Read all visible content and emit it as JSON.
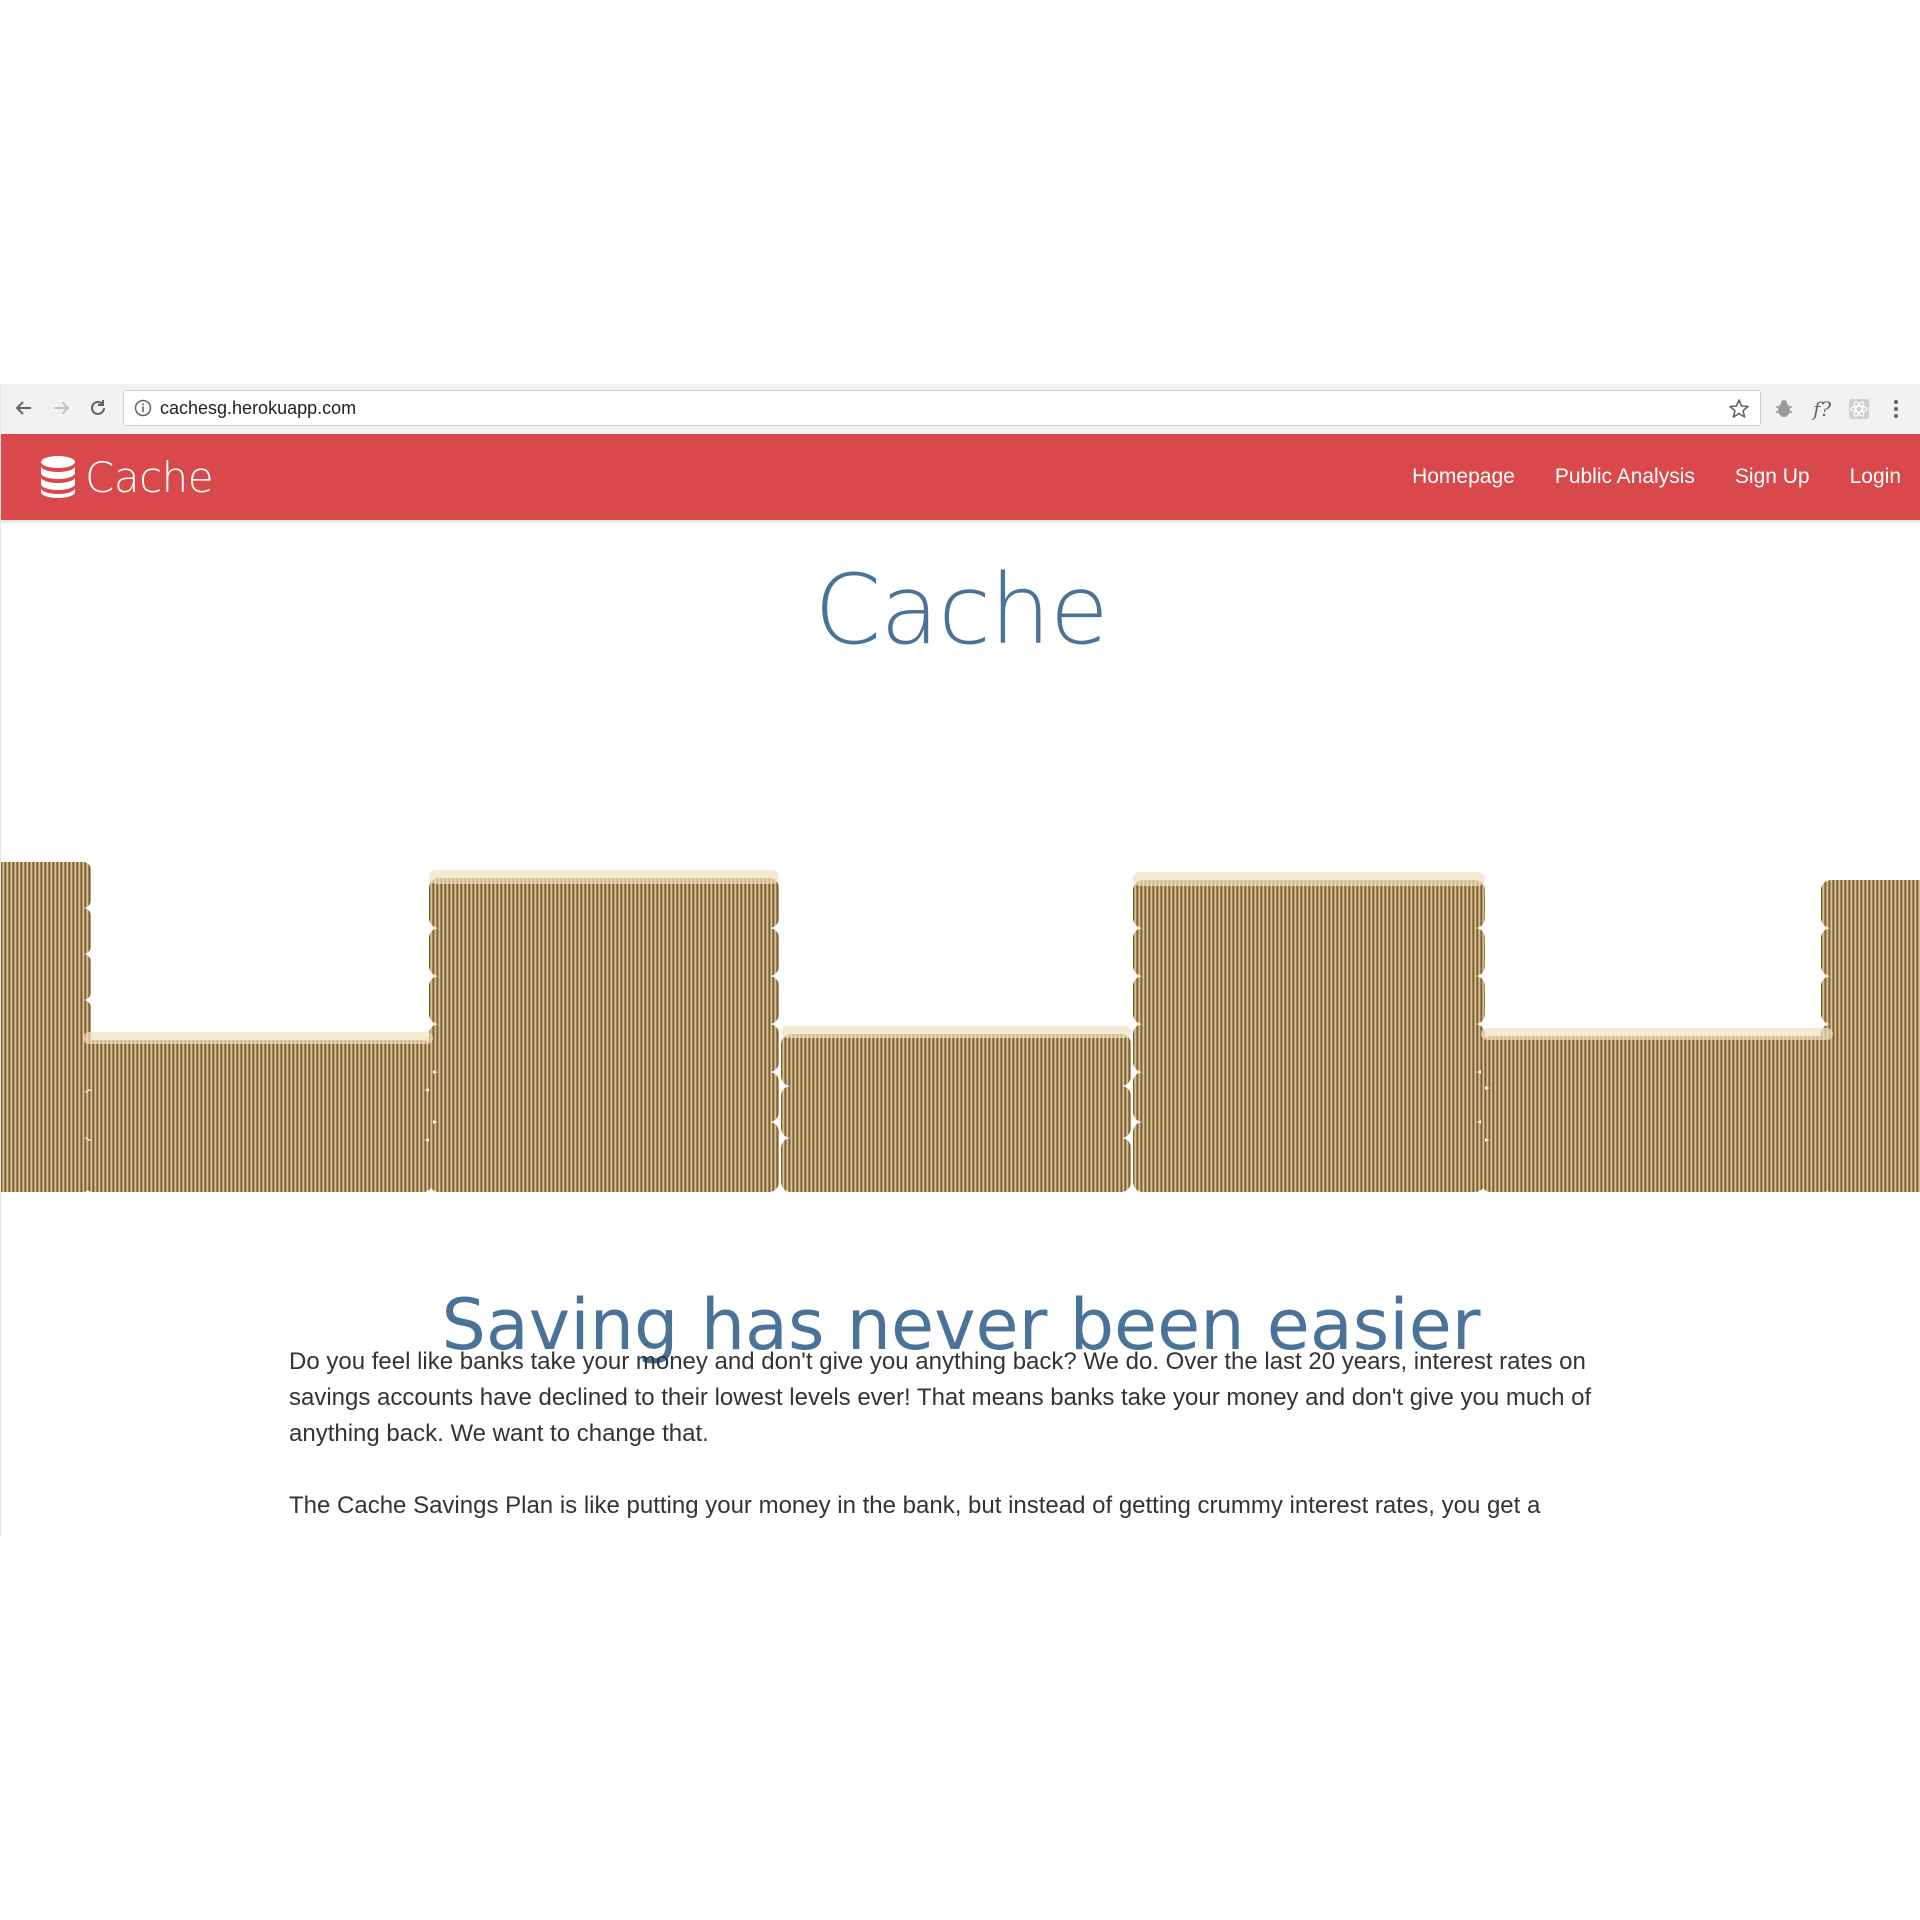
{
  "browser": {
    "url": "cachesg.herokuapp.com",
    "extension_label": "f?"
  },
  "navbar": {
    "brand": "Cache",
    "links": [
      "Homepage",
      "Public Analysis",
      "Sign Up",
      "Login"
    ],
    "color": "#d9494b"
  },
  "hero": {
    "title": "Cache",
    "banner_image": "stacks of gold pound coins"
  },
  "content": {
    "headline": "Saving has never been easier",
    "paragraph_1": "Do you feel like banks take your money and don't give you anything back? We do. Over the last 20 years, interest rates on savings accounts have declined to their lowest levels ever! That means banks take your money and don't give you much of anything back. We want to change that.",
    "paragraph_2": "The Cache Savings Plan is like putting your money in the bank, but instead of getting crummy interest rates, you get a"
  },
  "colors": {
    "accent": "#d9494b",
    "heading_blue": "#4b7399",
    "coin_gold": "#b08d4f"
  }
}
